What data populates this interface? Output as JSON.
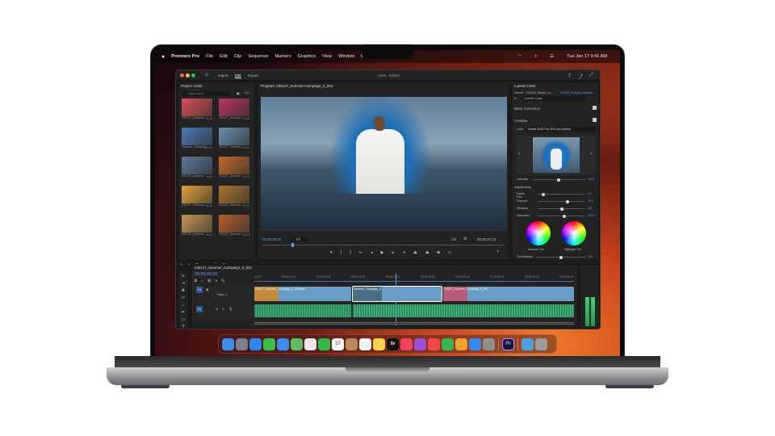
{
  "menubar": {
    "apple": "",
    "app_name": "Premiere Pro",
    "items": [
      "File",
      "Edit",
      "Clip",
      "Sequence",
      "Markers",
      "Graphics",
      "View",
      "Window",
      "Help"
    ],
    "clock": "Tue Jan 17  9:41 AM"
  },
  "window": {
    "tabs": [
      "Import",
      "Edit",
      "Export"
    ],
    "active_tab": "Edit",
    "title": "Calm - Edited"
  },
  "project": {
    "title": "Project: Calm",
    "file": "Calm.prproj",
    "count": "1/1...",
    "items": [
      {
        "label": "230127_Summer...",
        "dur": "00:18",
        "color": "#d94f5a"
      },
      {
        "label": "230127_Summer...",
        "dur": "00:24",
        "color": "#b73563"
      },
      {
        "label": "Summer_Campaig...",
        "dur": "00:15",
        "color": "#4d79b5"
      },
      {
        "label": "230127_Summer...",
        "dur": "00:12",
        "color": "#6a8fb0"
      },
      {
        "label": "230127_Summer...",
        "dur": "00:09",
        "color": "#5c7799"
      },
      {
        "label": "230127_Summer...",
        "dur": "00:21",
        "color": "#c26a2a"
      },
      {
        "label": "230127_Summer...",
        "dur": "00:16",
        "color": "#e0a238"
      },
      {
        "label": "230127_Summer...",
        "dur": "00:11",
        "color": "#a8742e"
      },
      {
        "label": "230127_Summer...",
        "dur": "00:14",
        "color": "#c69550"
      },
      {
        "label": "230127_Summer...",
        "dur": "00:20",
        "color": "#b85d2c"
      }
    ]
  },
  "program": {
    "title": "Program: 230127_Summer-Campaign_3_003",
    "timecode": "00;00;05;02",
    "fit": "Fit",
    "quality": "1/2",
    "duration": "00;00;37;13"
  },
  "lumetri": {
    "title": "Lumetri Color",
    "source": "Source · 221003_Ruby3_Lo...",
    "clip": "221003_Ruby3_Lumineti...",
    "effect": "Lumetri Color",
    "basic": "Basic Correction",
    "creative": "Creative",
    "look_label": "Look",
    "look_value": "Kodak 5205 Fuji 3510 (by Adobe)",
    "intensity_label": "Intensity",
    "intensity_value": "50.0",
    "adjustments": "Adjustments",
    "sliders": [
      {
        "label": "Faded Film",
        "value": "0.0",
        "pos": 0.1
      },
      {
        "label": "Sharpen",
        "value": "30.0",
        "pos": 0.65
      },
      {
        "label": "Vibrance",
        "value": "3.6",
        "pos": 0.52
      },
      {
        "label": "Saturation",
        "value": "110.0",
        "pos": 0.58
      }
    ],
    "shadow_tint": "Shadow Tint",
    "highlight_tint": "Highlight Tint",
    "tint_balance_label": "Tint Balance",
    "tint_balance_value": "0.0"
  },
  "timeline": {
    "sequence": "230127_Summer_Campaign_3_003",
    "timecode": "00;00;05;02",
    "ruler": [
      "00;00",
      "00;00;02;00",
      "00;00;04;00",
      "00;00;06;00",
      "00;00;08;00",
      "00;00;10;00",
      "00;00;12;00",
      "00;00;14;00",
      "00;00;16;00",
      "00;00;18;00",
      "00;00;20;00",
      "00;00;22;00",
      "00;00;24;00",
      "00;00;26;00",
      "00;00;28;00",
      "00;00;30;00",
      "00;00;32;00",
      "00;00;34;00",
      "00;00;36;00",
      "00;01;0"
    ],
    "tracks": [
      "V1",
      "A1"
    ],
    "track_label": "Video 1",
    "clips": [
      "230127_Summer_Campaign_3_003.mov",
      "Summer_Campaign_3...",
      "230127_Summer_Campaign_3_004"
    ]
  },
  "dock": {
    "apps": [
      {
        "name": "finder",
        "color": "#3b8fe6",
        "glyph": ""
      },
      {
        "name": "launchpad",
        "color": "#7a7f8a",
        "glyph": ""
      },
      {
        "name": "safari",
        "color": "#2a86f0",
        "glyph": ""
      },
      {
        "name": "messages",
        "color": "#38c24a",
        "glyph": ""
      },
      {
        "name": "mail",
        "color": "#3a8ef2",
        "glyph": ""
      },
      {
        "name": "maps",
        "color": "#5dbb63",
        "glyph": ""
      },
      {
        "name": "photos",
        "color": "#e8e8e8",
        "glyph": ""
      },
      {
        "name": "facetime",
        "color": "#34b94b",
        "glyph": ""
      },
      {
        "name": "calendar",
        "color": "#ffffff",
        "glyph": "17"
      },
      {
        "name": "contacts",
        "color": "#b9895a",
        "glyph": ""
      },
      {
        "name": "reminders",
        "color": "#f2f2f2",
        "glyph": ""
      },
      {
        "name": "notes",
        "color": "#f6d34a",
        "glyph": ""
      },
      {
        "name": "tv",
        "color": "#111111",
        "glyph": "tv"
      },
      {
        "name": "music",
        "color": "#f1435b",
        "glyph": ""
      },
      {
        "name": "podcasts",
        "color": "#9b4fdc",
        "glyph": ""
      },
      {
        "name": "news",
        "color": "#f04848",
        "glyph": ""
      },
      {
        "name": "numbers",
        "color": "#35b553",
        "glyph": ""
      },
      {
        "name": "pages",
        "color": "#f3a12e",
        "glyph": ""
      },
      {
        "name": "appstore",
        "color": "#2f8bf0",
        "glyph": ""
      },
      {
        "name": "settings",
        "color": "#8e8e93",
        "glyph": ""
      },
      {
        "name": "premiere",
        "color": "#1b1540",
        "glyph": "Pr"
      },
      {
        "name": "downloads",
        "color": "#4aa3e0",
        "glyph": ""
      },
      {
        "name": "trash",
        "color": "#9a9ca0",
        "glyph": ""
      }
    ]
  }
}
